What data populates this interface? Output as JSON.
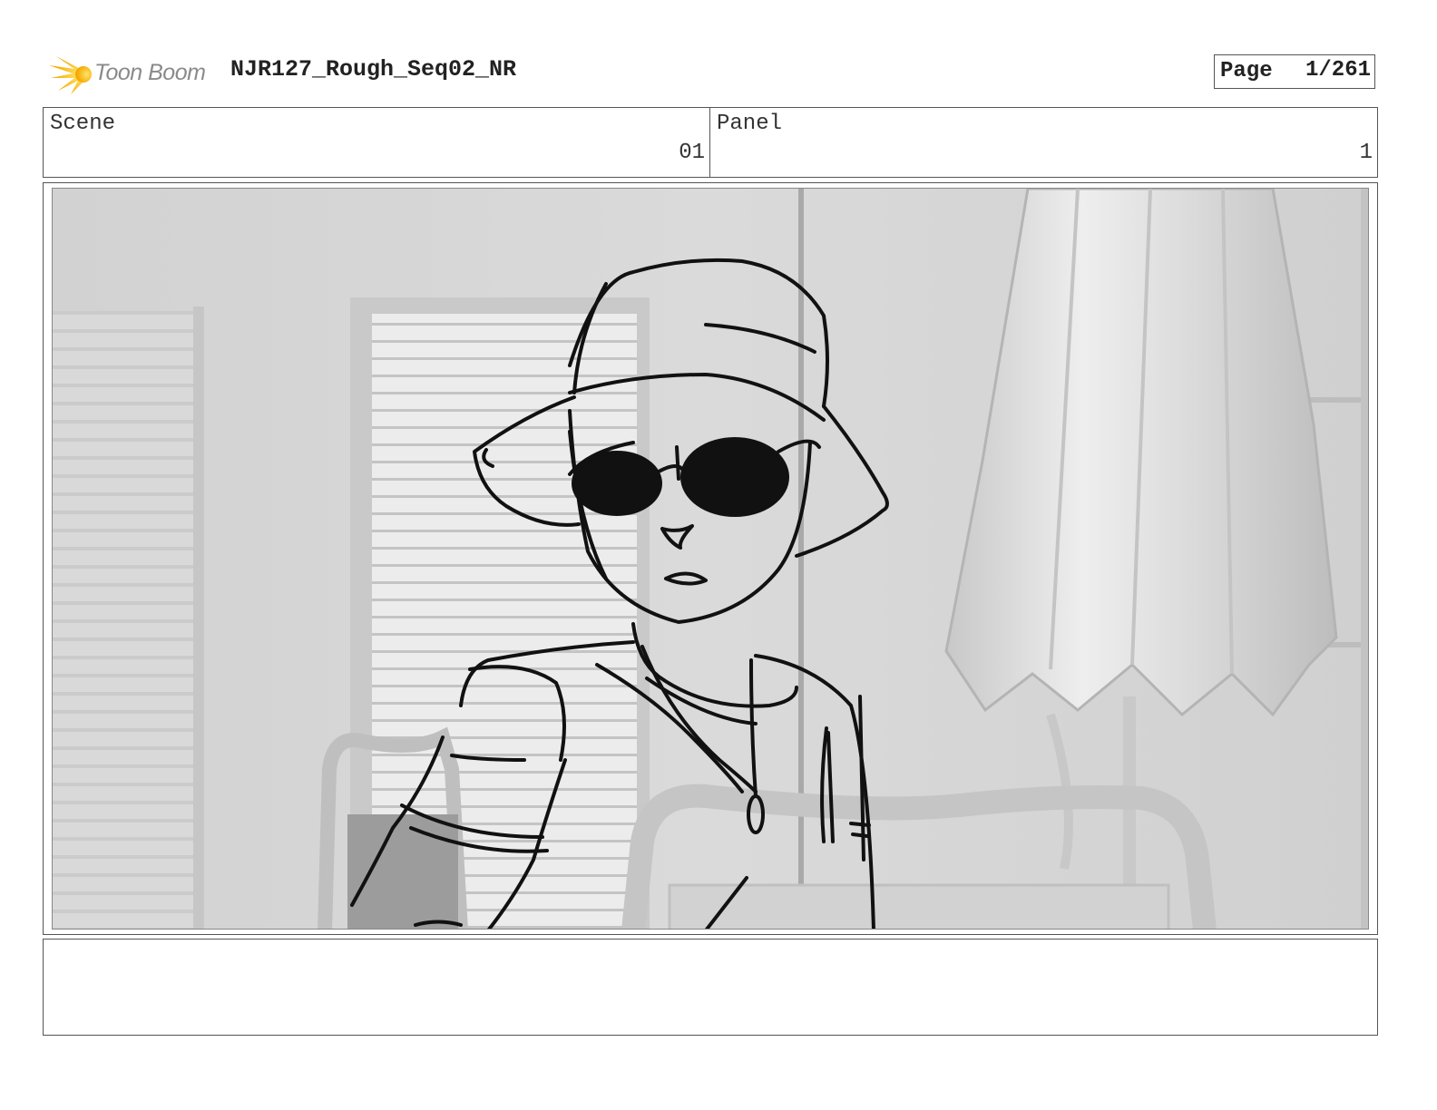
{
  "header": {
    "logo_text": "Toon Boom",
    "title": "NJR127_Rough_Seq02_NR",
    "page_label": "Page",
    "page_value": "1/261"
  },
  "info": {
    "scene_label": "Scene",
    "scene_value": "01",
    "panel_label": "Panel",
    "panel_value": "1"
  },
  "notes": {
    "text": ""
  }
}
